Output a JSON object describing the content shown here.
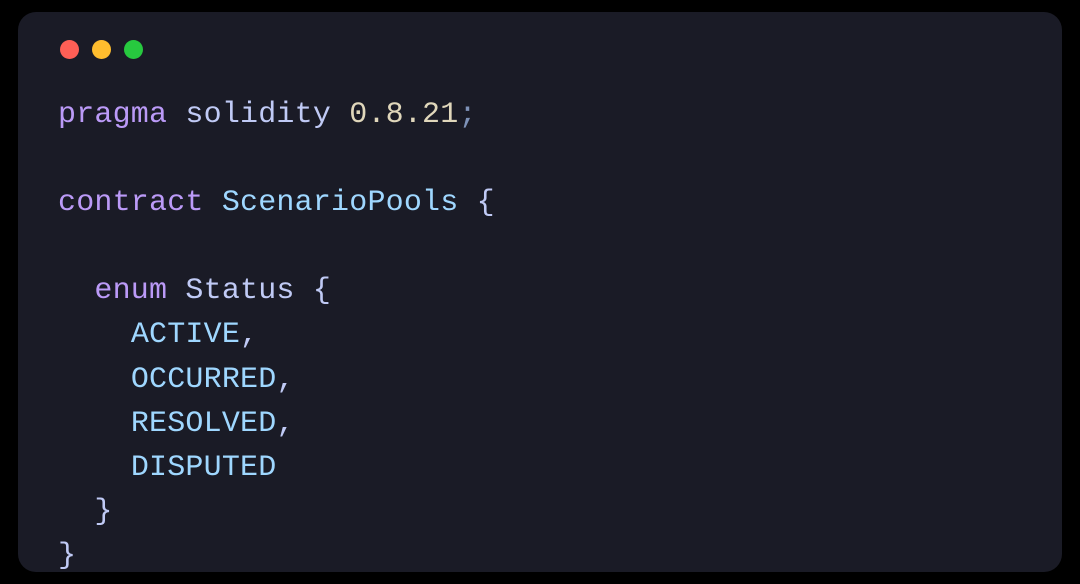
{
  "language": "solidity",
  "colors": {
    "background": "#1a1b26",
    "keyword": "#bb9af7",
    "identifier": "#c0caf5",
    "typename": "#9fd7ff",
    "number": "#e0d7bb",
    "trafficRed": "#ff5f56",
    "trafficYellow": "#ffbd2e",
    "trafficGreen": "#27c93f"
  },
  "code": {
    "pragma_kw": "pragma",
    "solidity_kw": "solidity",
    "version": "0.8.21",
    "contract_kw": "contract",
    "contract_name": "ScenarioPools",
    "enum_kw": "enum",
    "enum_name": "Status",
    "enum_values": [
      "ACTIVE",
      "OCCURRED",
      "RESOLVED",
      "DISPUTED"
    ],
    "open_brace": "{",
    "close_brace": "}",
    "semicolon": ";",
    "comma": ","
  }
}
